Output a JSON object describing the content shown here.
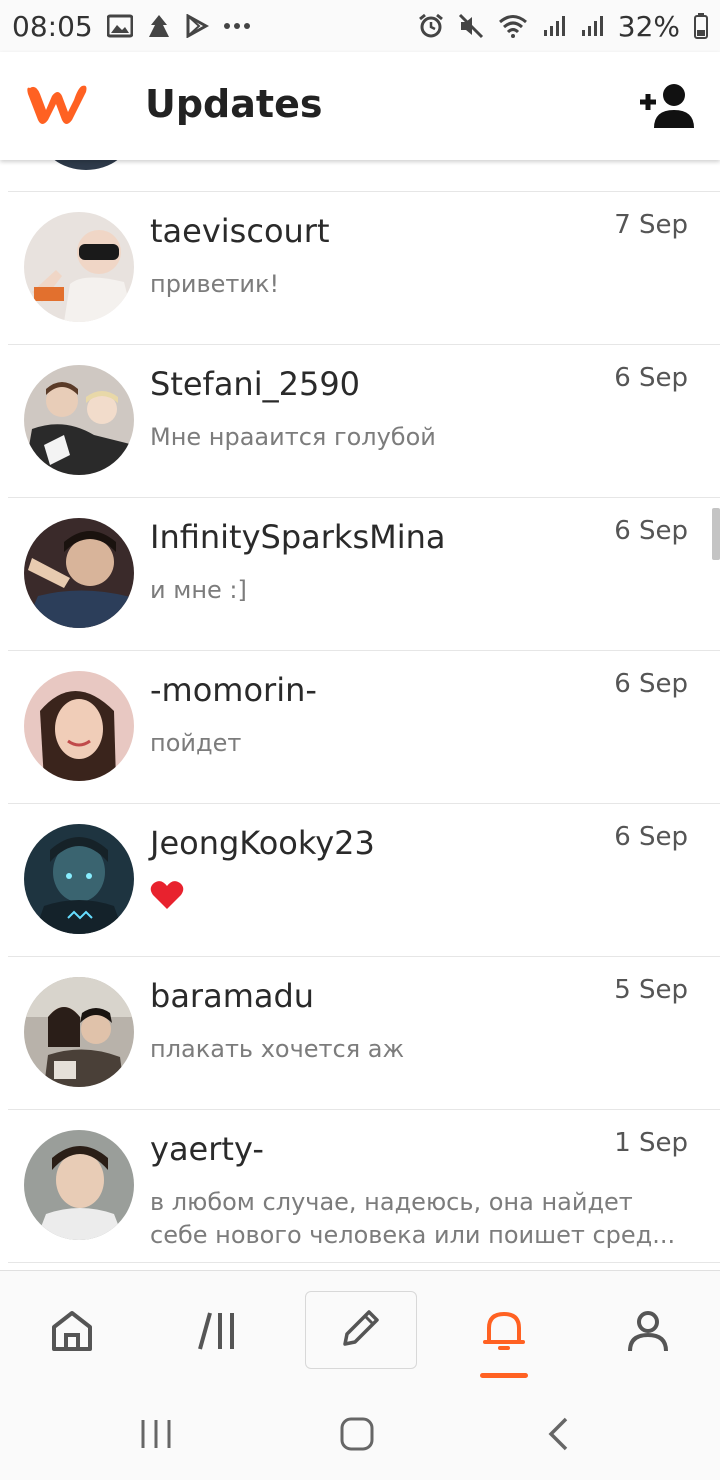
{
  "status_bar": {
    "time": "08:05",
    "battery": "32%",
    "left_icons": [
      "image-icon",
      "alert-icon",
      "play-store-icon",
      "more-icon"
    ],
    "right_icons": [
      "alarm-icon",
      "mute-icon",
      "wifi-icon",
      "signal-icon",
      "signal-icon",
      "battery-icon"
    ]
  },
  "app_bar": {
    "title": "Updates",
    "logo_color": "#ff6122"
  },
  "messages": [
    {
      "name": "taeviscourt",
      "date": "7 Sep",
      "text": "приветик!"
    },
    {
      "name": "Stefani_2590",
      "date": "6 Sep",
      "text": "Мне нраaится голубой"
    },
    {
      "name": "InfinitySparksMina",
      "date": "6 Sep",
      "text": "и мне :]"
    },
    {
      "name": "-momorin-",
      "date": "6 Sep",
      "text": "пойдет"
    },
    {
      "name": "JeongKooky23",
      "date": "6 Sep",
      "text": "❤️"
    },
    {
      "name": "baramadu",
      "date": "5 Sep",
      "text": "плакать хочется аж"
    },
    {
      "name": "yaerty-",
      "date": "1 Sep",
      "text": "в любом случае, надеюсь, она найдет себе нового человека или поишет сред..."
    }
  ],
  "bottom_nav": {
    "items": [
      "home-icon",
      "library-icon",
      "write-icon",
      "notifications-icon",
      "profile-icon"
    ],
    "active": "notifications-icon",
    "accent": "#ff6122"
  },
  "system_nav": [
    "recents-icon",
    "home-icon",
    "back-icon"
  ]
}
